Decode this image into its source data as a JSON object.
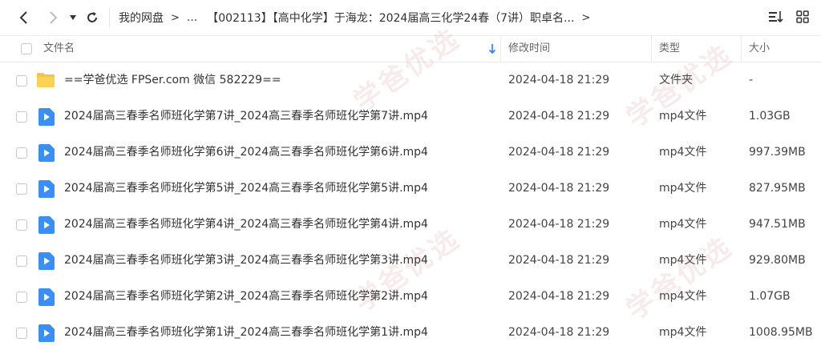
{
  "breadcrumb": {
    "items": [
      "我的网盘",
      "...",
      "【002113】【高中化学】于海龙：2024届高三化学24春（7讲）职卓名..."
    ],
    "separator": ">"
  },
  "columns": {
    "name": "文件名",
    "modified": "修改时间",
    "type": "类型",
    "size": "大小"
  },
  "files": [
    {
      "name": "==学爸优选 FPSer.com 微信 582229==",
      "modified": "2024-04-18 21:29",
      "type": "文件夹",
      "size": "-",
      "kind": "folder"
    },
    {
      "name": "2024届高三春季名师班化学第7讲_2024高三春季名师班化学第7讲.mp4",
      "modified": "2024-04-18 21:29",
      "type": "mp4文件",
      "size": "1.03GB",
      "kind": "video"
    },
    {
      "name": "2024届高三春季名师班化学第6讲_2024高三春季名师班化学第6讲.mp4",
      "modified": "2024-04-18 21:29",
      "type": "mp4文件",
      "size": "997.39MB",
      "kind": "video"
    },
    {
      "name": "2024届高三春季名师班化学第5讲_2024高三春季名师班化学第5讲.mp4",
      "modified": "2024-04-18 21:29",
      "type": "mp4文件",
      "size": "827.95MB",
      "kind": "video"
    },
    {
      "name": "2024届高三春季名师班化学第4讲_2024高三春季名师班化学第4讲.mp4",
      "modified": "2024-04-18 21:29",
      "type": "mp4文件",
      "size": "947.51MB",
      "kind": "video"
    },
    {
      "name": "2024届高三春季名师班化学第3讲_2024高三春季名师班化学第3讲.mp4",
      "modified": "2024-04-18 21:29",
      "type": "mp4文件",
      "size": "929.80MB",
      "kind": "video"
    },
    {
      "name": "2024届高三春季名师班化学第2讲_2024高三春季名师班化学第2讲.mp4",
      "modified": "2024-04-18 21:29",
      "type": "mp4文件",
      "size": "1.07GB",
      "kind": "video"
    },
    {
      "name": "2024届高三春季名师班化学第1讲_2024高三春季名师班化学第1讲.mp4",
      "modified": "2024-04-18 21:29",
      "type": "mp4文件",
      "size": "1008.95MB",
      "kind": "video"
    }
  ],
  "watermark": "学爸优选",
  "colors": {
    "video_icon": "#3a8ef6",
    "folder_icon": "#f7c444",
    "sort_arrow": "#2a7df0"
  }
}
